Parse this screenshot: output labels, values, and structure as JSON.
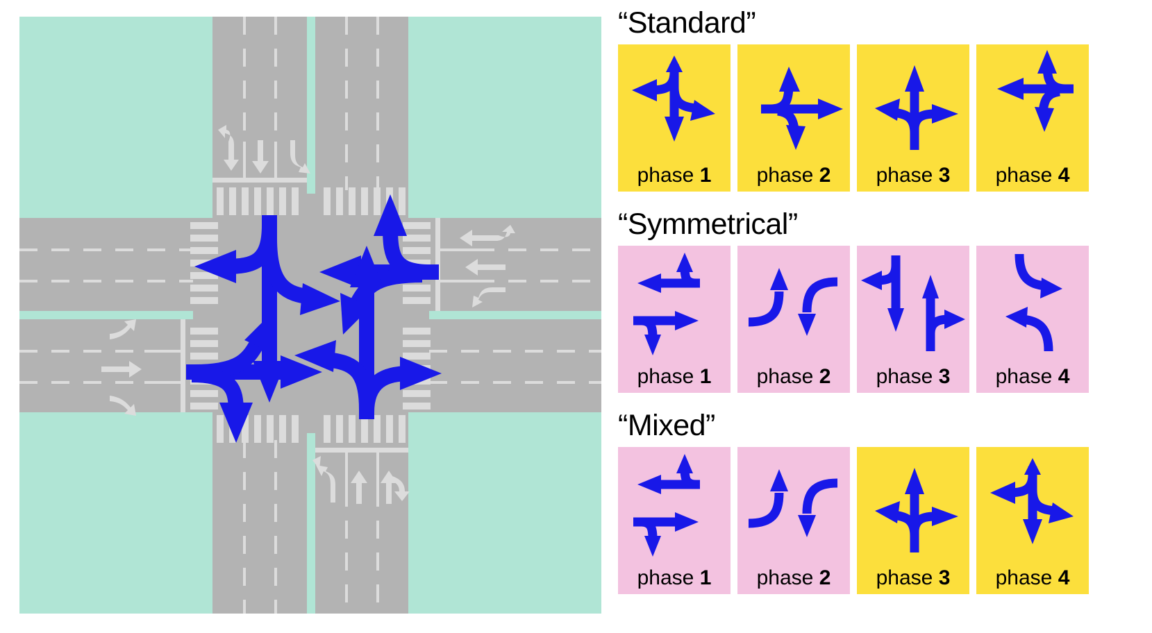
{
  "colors": {
    "grass": "#b0e5d5",
    "road": "#b3b3b3",
    "marking": "#dcdcdc",
    "arrow_blue": "#1818e8",
    "yellow": "#fcdf3c",
    "pink": "#f3c2e0",
    "text": "#000000",
    "background": "#ffffff"
  },
  "map": {
    "name": "four-leg-signalized-intersection",
    "approaches": [
      {
        "id": "north",
        "lane_markings": [
          "left-through-arrow",
          "through-arrow",
          "right-turn-arrow"
        ],
        "direction": "southbound-inbound"
      },
      {
        "id": "east",
        "lane_markings": [
          "left-through-arrow",
          "through-arrow",
          "right-turn-arrow"
        ],
        "direction": "westbound-inbound"
      },
      {
        "id": "south",
        "lane_markings": [
          "left-turn-arrow",
          "through-arrow",
          "right-turn-arrow"
        ],
        "direction": "northbound-inbound"
      },
      {
        "id": "west",
        "lane_markings": [
          "left-turn-arrow",
          "through-arrow",
          "right-turn-arrow"
        ],
        "direction": "eastbound-inbound"
      }
    ],
    "crosswalks": [
      "north",
      "east",
      "south",
      "west"
    ],
    "movements": [
      "north-left",
      "north-through",
      "north-right",
      "east-left",
      "east-through",
      "east-right",
      "south-left",
      "south-through",
      "south-right",
      "west-left",
      "west-through",
      "west-right"
    ]
  },
  "legend": {
    "groups": [
      {
        "title": "“Standard”",
        "scheme": "yellow",
        "phases": [
          {
            "label_word": "phase",
            "label_num": "1",
            "card_color": "yellow",
            "figure": "std1",
            "movements": [
              "north-through-south",
              "north-left-west",
              "north-right-east"
            ]
          },
          {
            "label_word": "phase",
            "label_num": "2",
            "card_color": "yellow",
            "figure": "std2",
            "movements": [
              "west-through-east",
              "west-left-north",
              "west-right-south"
            ]
          },
          {
            "label_word": "phase",
            "label_num": "3",
            "card_color": "yellow",
            "figure": "std3",
            "movements": [
              "south-through-north",
              "south-left-east",
              "south-right-west"
            ]
          },
          {
            "label_word": "phase",
            "label_num": "4",
            "card_color": "yellow",
            "figure": "std4",
            "movements": [
              "east-through-west",
              "east-left-south",
              "east-right-north"
            ]
          }
        ]
      },
      {
        "title": "“Symmetrical”",
        "scheme": "pink",
        "phases": [
          {
            "label_word": "phase",
            "label_num": "1",
            "card_color": "pink",
            "figure": "sym1",
            "movements": [
              "east-through-west",
              "west-through-east",
              "east-right-south",
              "west-right-north"
            ]
          },
          {
            "label_word": "phase",
            "label_num": "2",
            "card_color": "pink",
            "figure": "sym2",
            "movements": [
              "west-left-north",
              "east-left-south"
            ]
          },
          {
            "label_word": "phase",
            "label_num": "3",
            "card_color": "pink",
            "figure": "sym3",
            "movements": [
              "north-through-south",
              "south-through-north",
              "north-right-west",
              "south-right-east"
            ]
          },
          {
            "label_word": "phase",
            "label_num": "4",
            "card_color": "pink",
            "figure": "sym4",
            "movements": [
              "north-left-east",
              "south-left-west"
            ]
          }
        ]
      },
      {
        "title": "“Mixed”",
        "scheme": "mixed",
        "phases": [
          {
            "label_word": "phase",
            "label_num": "1",
            "card_color": "pink",
            "figure": "sym1",
            "movements": [
              "east-through-west",
              "west-through-east",
              "east-right-south",
              "west-right-north"
            ]
          },
          {
            "label_word": "phase",
            "label_num": "2",
            "card_color": "pink",
            "figure": "sym2",
            "movements": [
              "west-left-north",
              "east-left-south"
            ]
          },
          {
            "label_word": "phase",
            "label_num": "3",
            "card_color": "yellow",
            "figure": "std3",
            "movements": [
              "south-through-north",
              "south-left-east",
              "south-right-west"
            ]
          },
          {
            "label_word": "phase",
            "label_num": "4",
            "card_color": "yellow",
            "figure": "std1",
            "movements": [
              "north-through-south",
              "north-left-west",
              "north-right-east"
            ]
          }
        ]
      }
    ]
  }
}
